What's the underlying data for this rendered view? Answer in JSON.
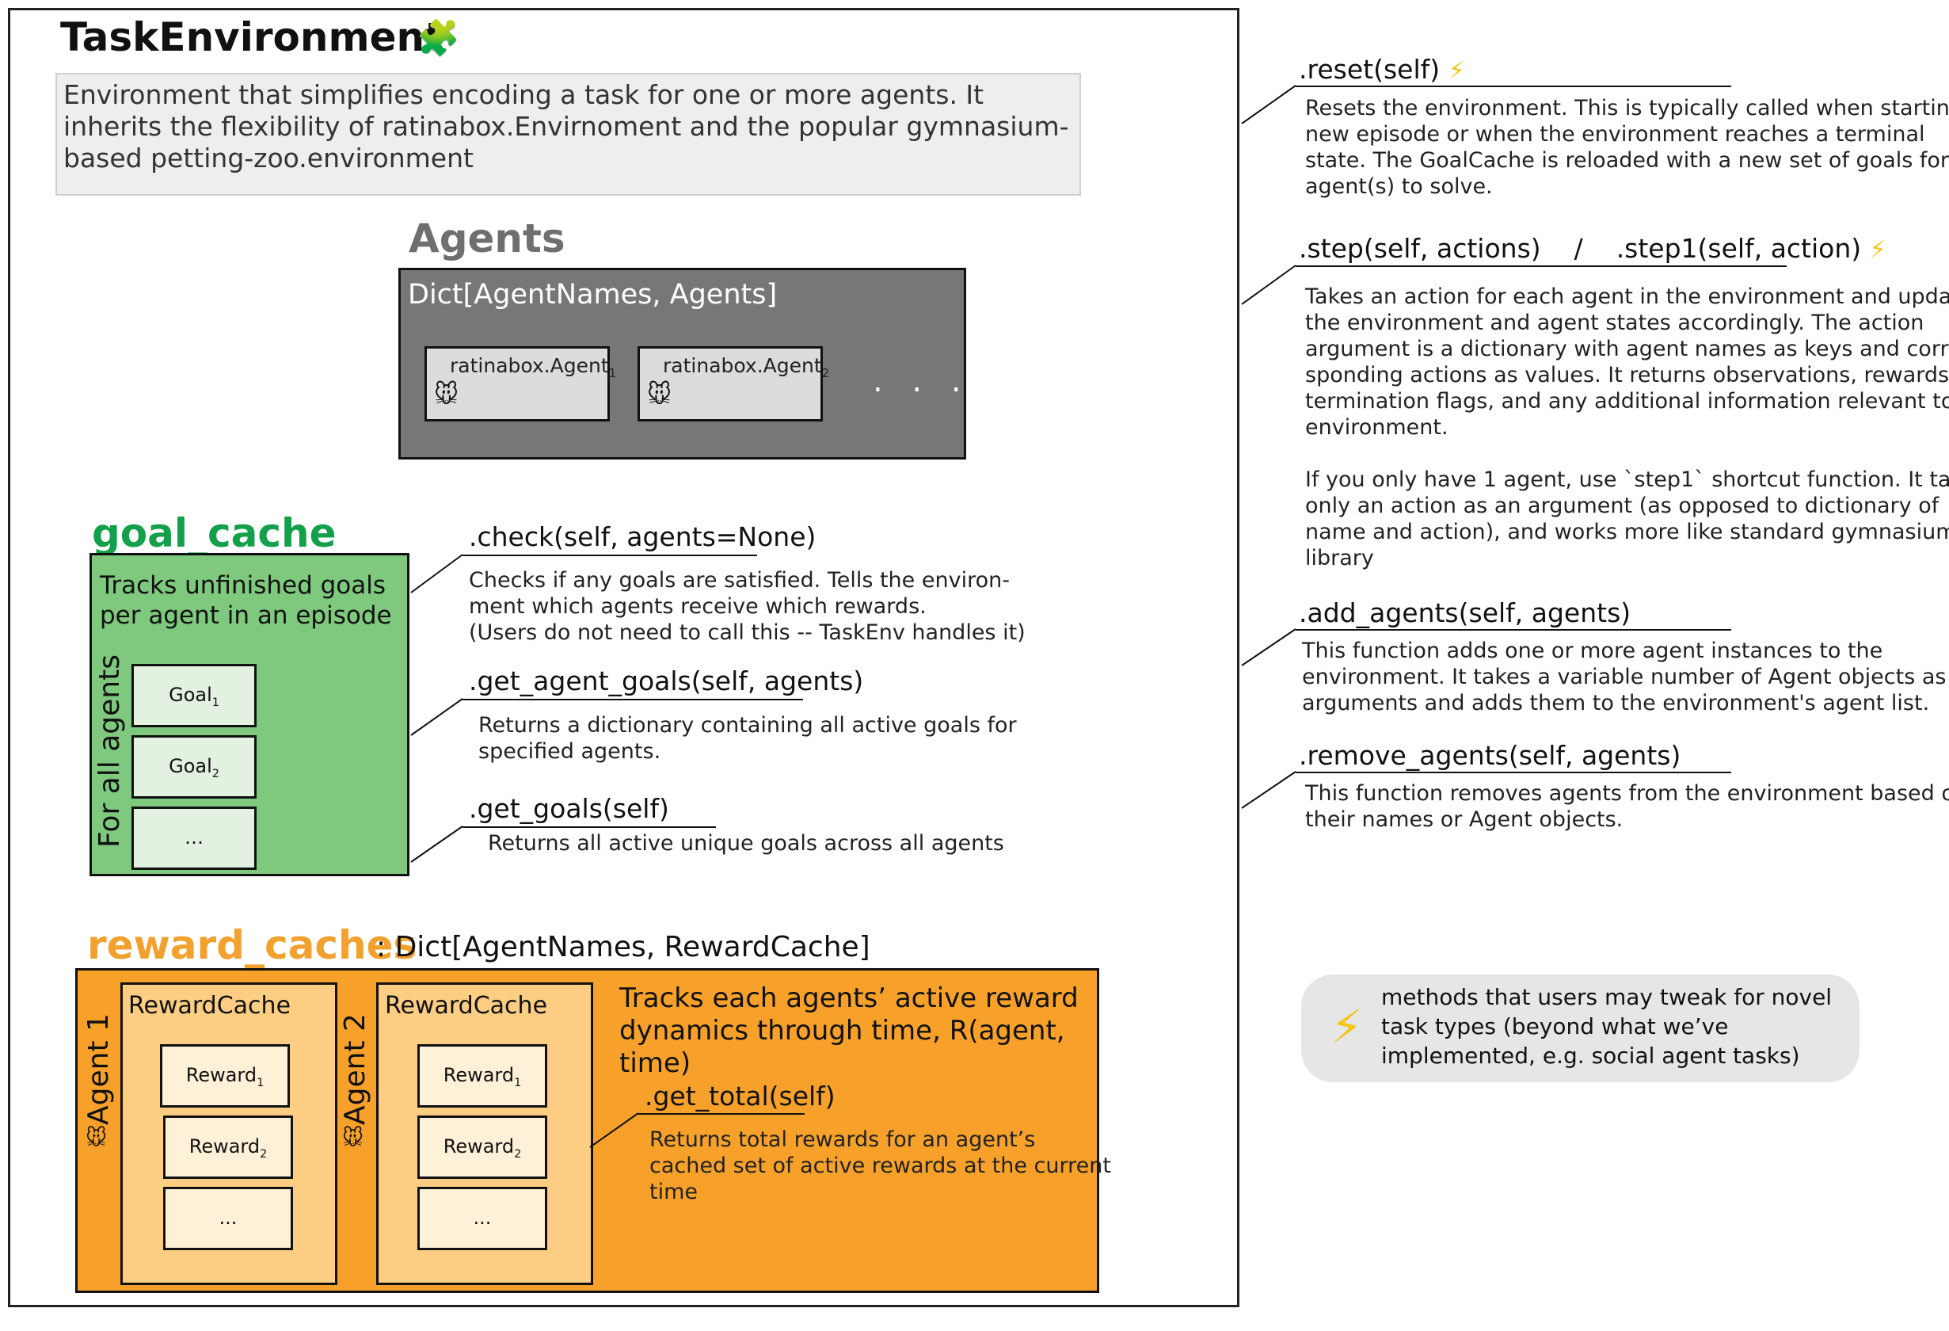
{
  "title": "TaskEnvironment",
  "title_icon": "puzzle-icon",
  "description": "Environment that simplifies encoding a task for one or more agents. It inherits the flexibility of ratinabox.Envirnoment and the popular gymnasium-based petting-zoo.environment",
  "agents": {
    "title": "Agents",
    "dict_label": "Dict[AgentNames, Agents]",
    "cards": [
      {
        "label": "ratinabox.Agent",
        "sub": "1",
        "icon": "mouse-icon"
      },
      {
        "label": "ratinabox.Agent",
        "sub": "2",
        "icon": "mouse-icon"
      }
    ],
    "ellipsis": ". . ."
  },
  "goal_cache": {
    "title": "goal_cache",
    "description": "Tracks unfinished goals per agent in an episode",
    "vertical_label": "For all agents",
    "goals": [
      {
        "label": "Goal",
        "sub": "1"
      },
      {
        "label": "Goal",
        "sub": "2"
      },
      {
        "label": "…",
        "sub": ""
      }
    ],
    "methods": [
      {
        "name": ".check(self, agents=None)",
        "desc": "Checks if any goals are satisfied. Tells the environ-\nment which agents receive which rewards.\n(Users do not need to call this -- TaskEnv handles it)"
      },
      {
        "name": ".get_agent_goals(self, agents)",
        "desc": "Returns a dictionary containing all active goals for\nspecified agents."
      },
      {
        "name": ".get_goals(self)",
        "desc": "Returns all active unique goals across all agents"
      }
    ]
  },
  "reward_caches": {
    "title": "reward_caches",
    "type_label": ": Dict[AgentNames, RewardCache]",
    "description": "Tracks each agents’ active reward dynamics through time, R(agent, time)",
    "caches": [
      {
        "agent_label": "Agent 1",
        "title": "RewardCache",
        "items": [
          {
            "label": "Reward",
            "sub": "1"
          },
          {
            "label": "Reward",
            "sub": "2"
          },
          {
            "label": "...",
            "sub": ""
          }
        ]
      },
      {
        "agent_label": "Agent 2",
        "title": "RewardCache",
        "items": [
          {
            "label": "Reward",
            "sub": "1"
          },
          {
            "label": "Reward",
            "sub": "2"
          },
          {
            "label": "...",
            "sub": ""
          }
        ]
      }
    ],
    "method": {
      "name": ".get_total(self)",
      "desc": "Returns total rewards for an agent’s\ncached set of active rewards at the current\ntime"
    }
  },
  "env_methods": [
    {
      "name": ".reset(self)",
      "tweakable": true,
      "desc": "Resets the environment. This is typically called when starting a\nnew episode or when the environment reaches a terminal\nstate. The GoalCache is reloaded with a new set of goals for the\nagent(s) to solve."
    },
    {
      "name": ".step(self, actions)    /    .step1(self, action)",
      "tweakable": true,
      "desc": "Takes an action for each agent in the environment and updates\nthe environment and agent states accordingly. The action\nargument is a dictionary with agent names as keys and corre-\nsponding actions as values. It returns observations, rewards,\ntermination flags, and any additional information relevant to the\nenvironment.\n\nIf you only have 1 agent, use `step1` shortcut function. It takes\nonly an action as an argument (as opposed to dictionary of\nname and action), and works more like standard gymnasium\nlibrary"
    },
    {
      "name": ".add_agents(self,  agents)",
      "tweakable": false,
      "desc": "This function adds one or more agent instances to the\nenvironment. It takes a variable number of Agent objects as\narguments and adds them to the environment's agent list."
    },
    {
      "name": ".remove_agents(self,  agents)",
      "tweakable": false,
      "desc": "This function removes agents from the environment based on\ntheir names or Agent objects."
    }
  ],
  "legend": {
    "icon": "lightning-icon",
    "text": "methods that users may tweak for novel task types (beyond what we’ve implemented,  e.g. social agent tasks)"
  },
  "colors": {
    "goal_green": "#7fc97f",
    "goal_title": "#14a04a",
    "reward_orange": "#f7a12a",
    "reward_title": "#f2a12f",
    "agents_gray": "#77777a",
    "bolt": "#f5c518"
  }
}
